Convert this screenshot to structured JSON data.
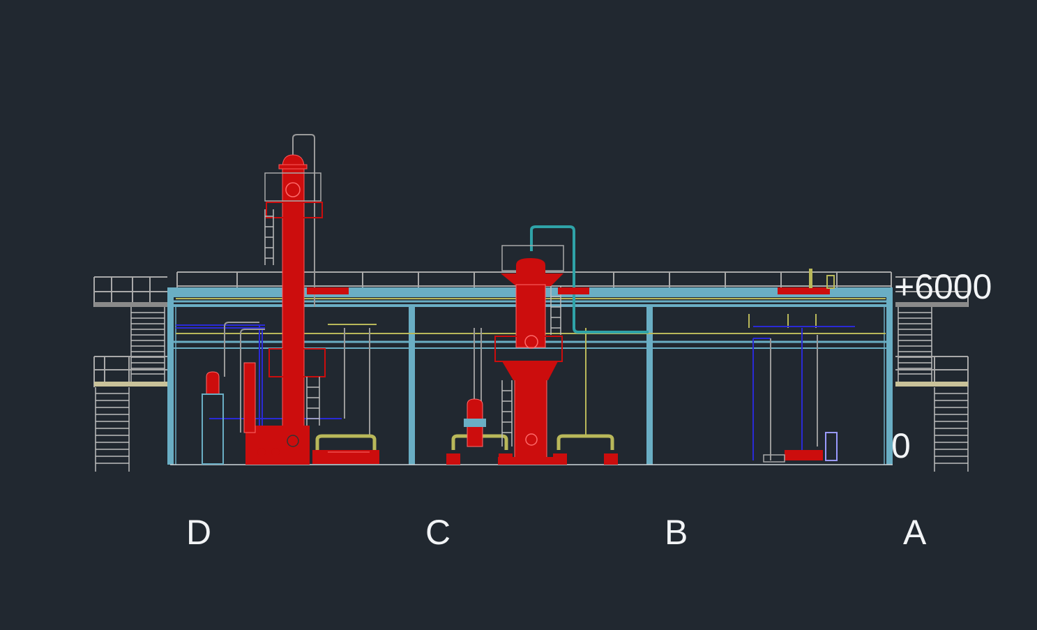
{
  "drawing": {
    "background_color": "#212830",
    "elevation_labels": {
      "top": "+6000",
      "bottom": "0"
    },
    "grid_axes": [
      "D",
      "C",
      "B",
      "A"
    ],
    "colors": {
      "structure": "#6aaec4",
      "railing": "#a9a9a9",
      "equipment": "#cc0d0d",
      "pipe_yellow": "#b9b85a",
      "pipe_blue": "#2a2ad6",
      "pipe_cyan": "#2fa3a8",
      "text": "#f2f4f6"
    }
  }
}
